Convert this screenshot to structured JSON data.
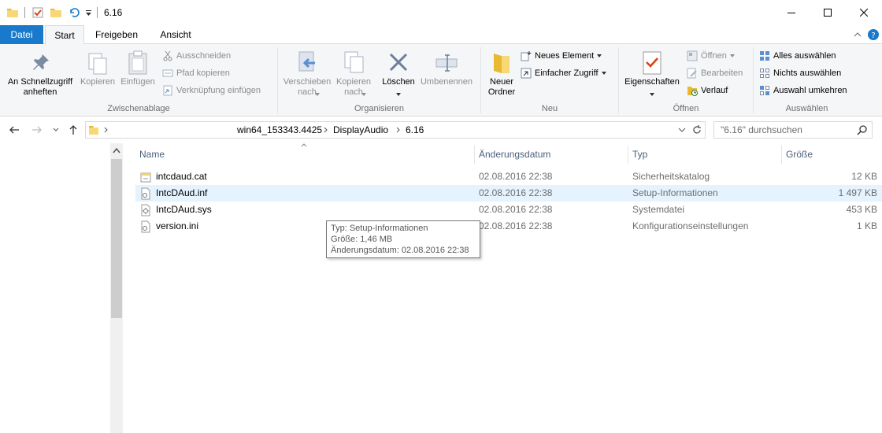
{
  "window": {
    "title": "6.16"
  },
  "tabs": {
    "datei": "Datei",
    "start": "Start",
    "freigeben": "Freigeben",
    "ansicht": "Ansicht"
  },
  "ribbon": {
    "zwischenablage": {
      "label": "Zwischenablage",
      "pin": "An Schnellzugriff\nanheften",
      "copy": "Kopieren",
      "paste": "Einfügen",
      "cut": "Ausschneiden",
      "copy_path": "Pfad kopieren",
      "paste_shortcut": "Verknüpfung einfügen"
    },
    "organisieren": {
      "label": "Organisieren",
      "move": "Verschieben\nnach",
      "copy_to": "Kopieren\nnach",
      "delete": "Löschen",
      "rename": "Umbenennen"
    },
    "neu": {
      "label": "Neu",
      "new_folder": "Neuer\nOrdner",
      "new_item": "Neues Element",
      "easy_access": "Einfacher Zugriff"
    },
    "oeffnen": {
      "label": "Öffnen",
      "properties": "Eigenschaften",
      "open": "Öffnen",
      "edit": "Bearbeiten",
      "history": "Verlauf"
    },
    "auswaehlen": {
      "label": "Auswählen",
      "select_all": "Alles auswählen",
      "select_none": "Nichts auswählen",
      "invert": "Auswahl umkehren"
    }
  },
  "address": {
    "crumbs": [
      "win64_153343.4425",
      "DisplayAudio",
      "6.16"
    ],
    "search_placeholder": "\"6.16\" durchsuchen"
  },
  "columns": {
    "name": "Name",
    "date": "Änderungsdatum",
    "type": "Typ",
    "size": "Größe"
  },
  "files": [
    {
      "name": "intcdaud.cat",
      "date": "02.08.2016 22:38",
      "type": "Sicherheitskatalog",
      "size": "12 KB"
    },
    {
      "name": "IntcDAud.inf",
      "date": "02.08.2016 22:38",
      "type": "Setup-Informationen",
      "size": "1 497 KB"
    },
    {
      "name": "IntcDAud.sys",
      "date": "02.08.2016 22:38",
      "type": "Systemdatei",
      "size": "453 KB"
    },
    {
      "name": "version.ini",
      "date": "02.08.2016 22:38",
      "type": "Konfigurationseinstellungen",
      "size": "1 KB"
    }
  ],
  "tooltip": {
    "line1": "Typ: Setup-Informationen",
    "line2": "Größe: 1,46 MB",
    "line3": "Änderungsdatum: 02.08.2016 22:38"
  },
  "colors": {
    "accent": "#1979ca",
    "hover": "#e5f3ff"
  }
}
